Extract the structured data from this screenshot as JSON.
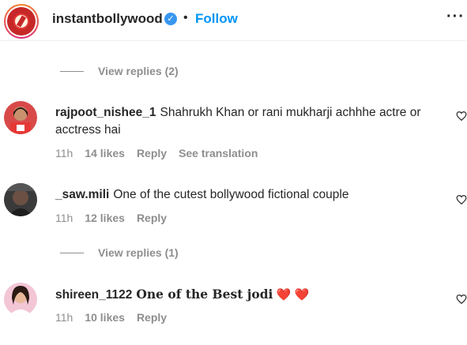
{
  "header": {
    "username": "instantbollywood",
    "dot": "•",
    "follow_label": "Follow",
    "more": "···"
  },
  "replies": [
    {
      "label": "View replies (2)"
    },
    {
      "label": "View replies (1)"
    }
  ],
  "comments": [
    {
      "username": "rajpoot_nishee_1",
      "text": "Shahrukh Khan or rani mukharji achhhe actre or acctress hai",
      "time": "11h",
      "likes": "14 likes",
      "reply": "Reply",
      "translation": "See translation"
    },
    {
      "username": "_saw.mili",
      "text": "One of the cutest bollywood fictional couple",
      "time": "11h",
      "likes": "12 likes",
      "reply": "Reply"
    },
    {
      "username": "shireen_1122",
      "text": "One of the Best jodi",
      "emoji": "❤️ ❤️",
      "time": "11h",
      "likes": "10 likes",
      "reply": "Reply"
    }
  ],
  "colors": {
    "accent": "#0095f6",
    "muted": "#8e8e8e",
    "verified": "#3897f0"
  }
}
